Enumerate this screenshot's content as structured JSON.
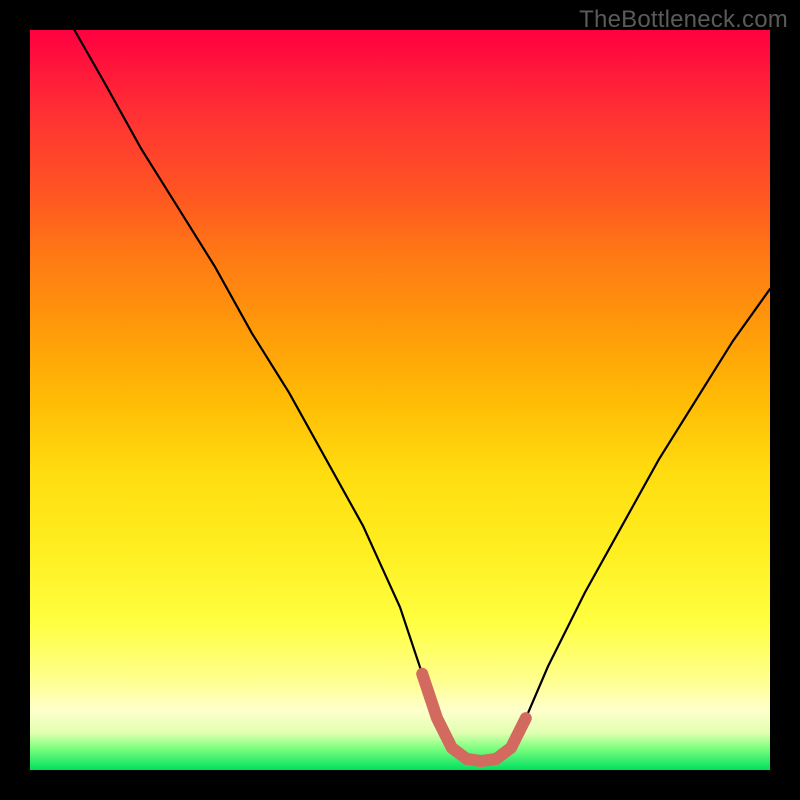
{
  "watermark": "TheBottleneck.com",
  "chart_data": {
    "type": "line",
    "title": "",
    "xlabel": "",
    "ylabel": "",
    "xlim": [
      0,
      100
    ],
    "ylim": [
      0,
      100
    ],
    "series": [
      {
        "name": "bottleneck-curve",
        "x": [
          6,
          10,
          15,
          20,
          25,
          30,
          35,
          40,
          45,
          50,
          53,
          55,
          57,
          59,
          61,
          63,
          65,
          67,
          70,
          75,
          80,
          85,
          90,
          95,
          100
        ],
        "values": [
          100,
          93,
          84,
          76,
          68,
          59,
          51,
          42,
          33,
          22,
          13,
          7,
          3,
          1.5,
          1.2,
          1.5,
          3,
          7,
          14,
          24,
          33,
          42,
          50,
          58,
          65
        ]
      },
      {
        "name": "flat-bottom-marker",
        "x": [
          53,
          55,
          57,
          59,
          61,
          63,
          65,
          67
        ],
        "values": [
          13,
          7,
          3,
          1.5,
          1.2,
          1.5,
          3,
          7
        ]
      }
    ],
    "colors": {
      "curve": "#000000",
      "marker": "#d36a60",
      "gradient_top": "#ff0040",
      "gradient_bottom": "#00e060"
    }
  }
}
